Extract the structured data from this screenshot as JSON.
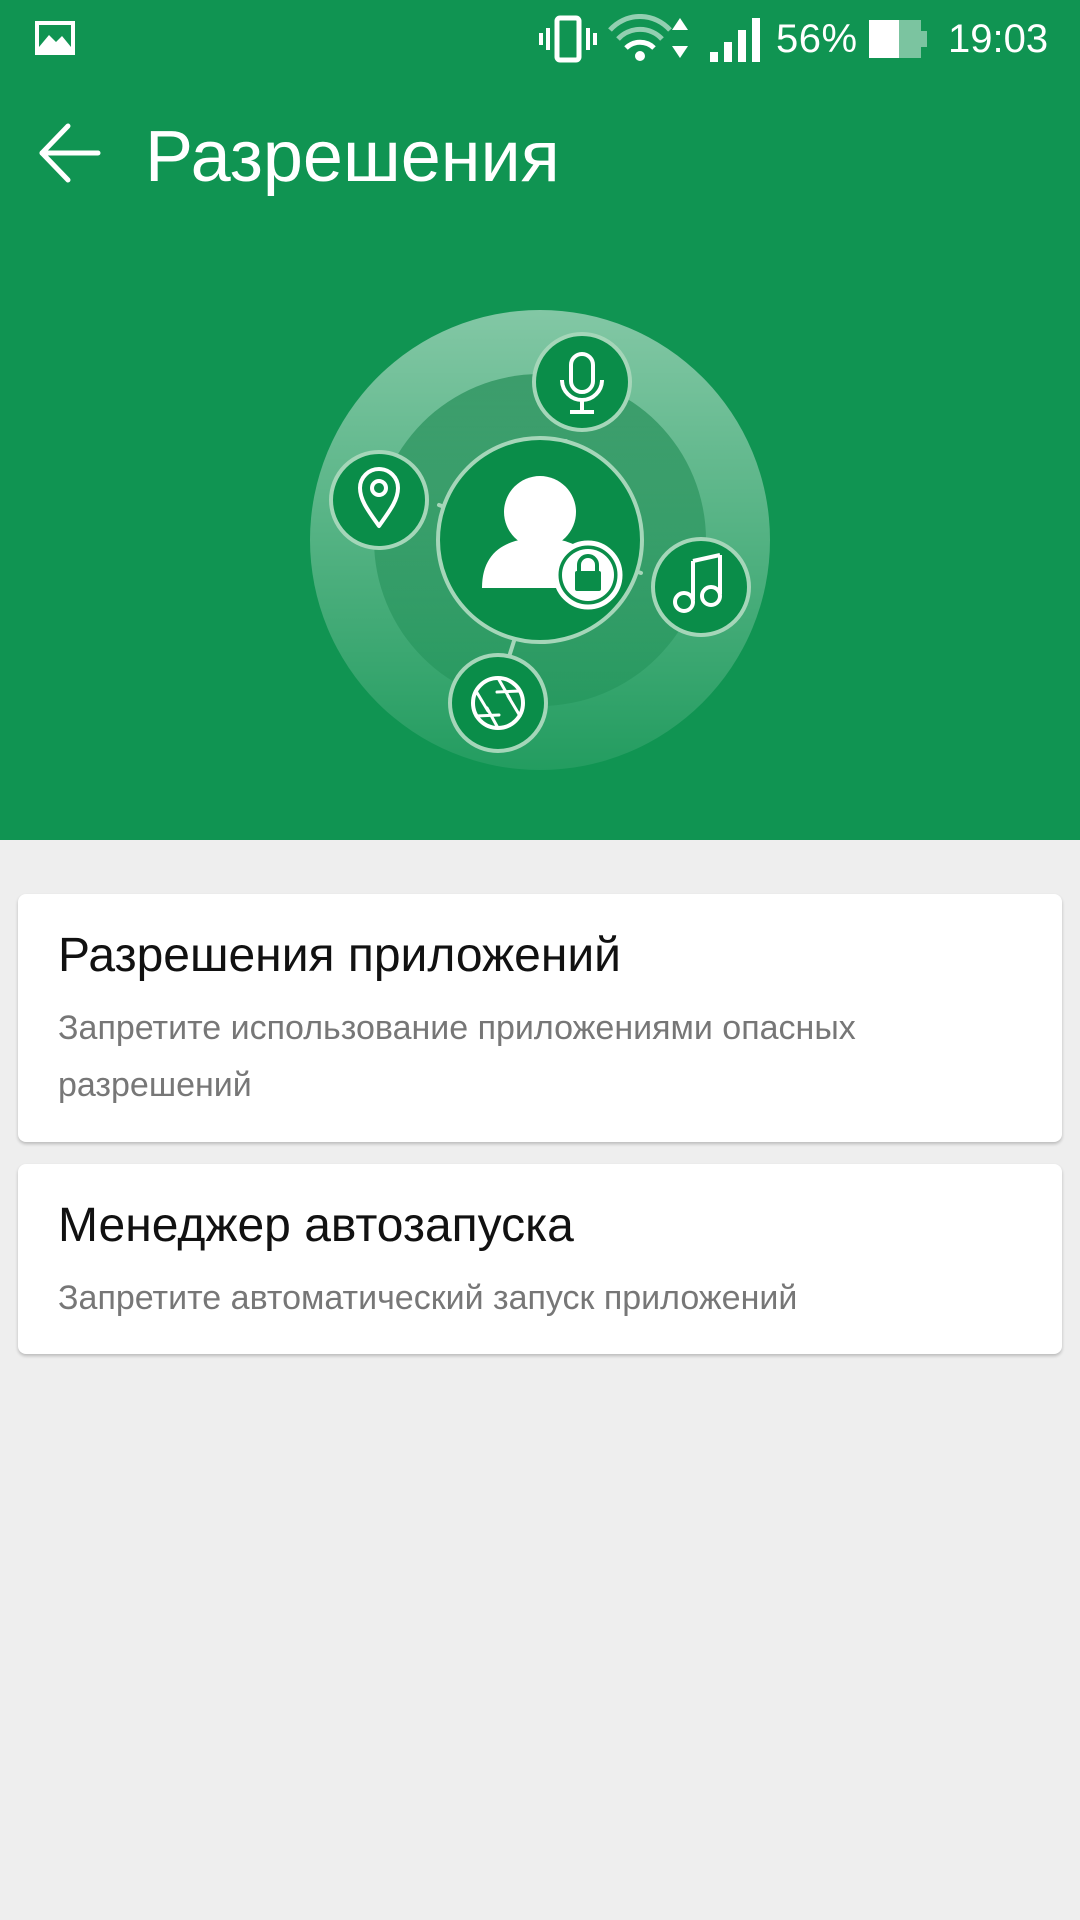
{
  "status_bar": {
    "battery_percent": "56%",
    "time": "19:03",
    "icons": [
      "gallery-icon",
      "vibrate-icon",
      "wifi-icon",
      "signal-icon",
      "battery-icon"
    ]
  },
  "toolbar": {
    "back_icon": "arrow-left-icon",
    "title": "Разрешения"
  },
  "hero": {
    "center_icon": "user-lock-icon",
    "satellite_icons": [
      "microphone-icon",
      "location-pin-icon",
      "music-note-icon",
      "camera-aperture-icon"
    ]
  },
  "cards": [
    {
      "title": "Разрешения приложений",
      "description": "Запретите использование приложениями опасных разрешений"
    },
    {
      "title": "Менеджер автозапуска",
      "description": "Запретите автоматический запуск приложений"
    }
  ],
  "colors": {
    "header_green": "#109452",
    "page_background": "#eeeeee",
    "card_background": "#ffffff",
    "title_text": "#111111",
    "description_text": "#777777"
  }
}
